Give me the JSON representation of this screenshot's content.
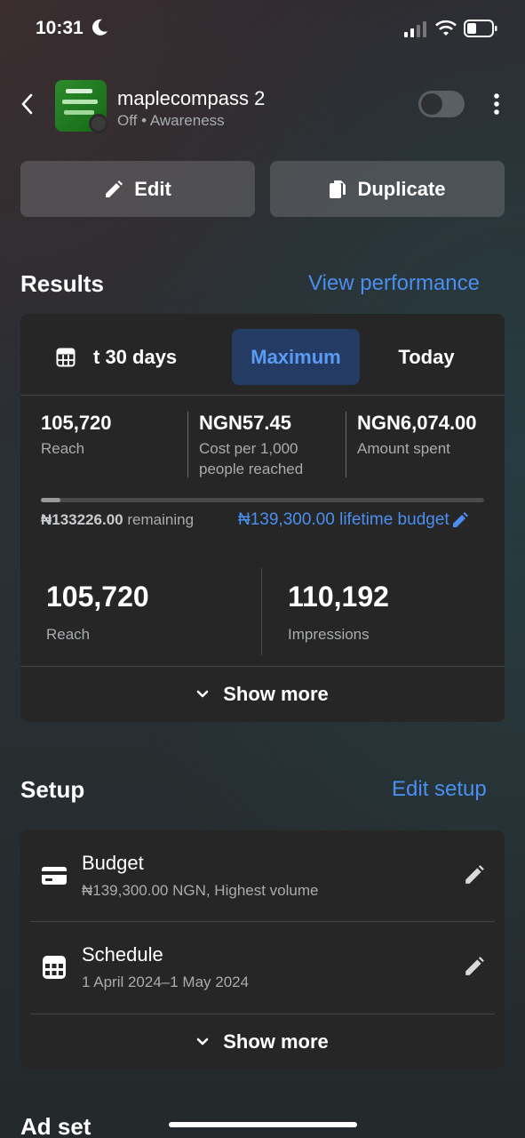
{
  "status_bar": {
    "time": "10:31",
    "icons": [
      "moon-icon",
      "signal-icon",
      "wifi-icon",
      "battery-icon"
    ]
  },
  "header": {
    "campaign_name": "maplecompass 2",
    "status": "Off",
    "objective": "Awareness",
    "toggle_on": false
  },
  "actions": {
    "edit_label": "Edit",
    "duplicate_label": "Duplicate"
  },
  "results": {
    "title": "Results",
    "link": "View performance",
    "tabs": [
      {
        "label": "t 30 days"
      },
      {
        "label": "Maximum",
        "selected": true
      },
      {
        "label": "Today"
      }
    ],
    "stats": [
      {
        "value": "105,720",
        "label": "Reach"
      },
      {
        "value": "NGN57.45",
        "label": "Cost per 1,000 people reached"
      },
      {
        "value": "NGN6,074.00",
        "label": "Amount spent"
      }
    ],
    "budget_progress": 0.044,
    "remaining_amount": "₦133226.00",
    "remaining_label": "remaining",
    "lifetime_budget": "₦139,300.00 lifetime budget",
    "big_stats": [
      {
        "value": "105,720",
        "label": "Reach"
      },
      {
        "value": "110,192",
        "label": "Impressions"
      }
    ],
    "show_more": "Show more"
  },
  "setup": {
    "title": "Setup",
    "link": "Edit setup",
    "rows": [
      {
        "title": "Budget",
        "subtitle": "₦139,300.00 NGN, Highest volume"
      },
      {
        "title": "Schedule",
        "subtitle": "1 April 2024–1 May 2024"
      }
    ],
    "show_more": "Show more"
  },
  "next_section": {
    "title": "Ad set"
  },
  "colors": {
    "accent": "#4a8ff0",
    "card": "#262626",
    "selected_tab_bg": "#243b64"
  }
}
